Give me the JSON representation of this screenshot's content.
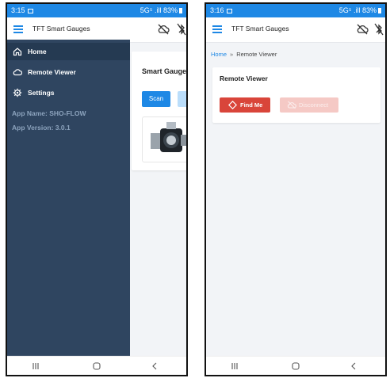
{
  "left_screen": {
    "status": {
      "time": "3:15",
      "right": "5G⁵ .ill 83%"
    },
    "appbar": {
      "title": "TFT Smart Gauges"
    },
    "drawer": {
      "items": [
        {
          "label": "Home",
          "icon": "home-icon",
          "active": true
        },
        {
          "label": "Remote Viewer",
          "icon": "cloud-icon",
          "active": false
        },
        {
          "label": "Settings",
          "icon": "gear-icon",
          "active": false
        }
      ],
      "app_name": "App Name: SHO-FLOW",
      "app_version": "App Version: 3.0.1"
    },
    "card": {
      "title": "Smart Gauges",
      "scan_label": "Scan"
    }
  },
  "right_screen": {
    "status": {
      "time": "3:16",
      "right": "5G⁵ .ill 83%"
    },
    "appbar": {
      "title": "TFT Smart Gauges"
    },
    "breadcrumb": {
      "home": "Home",
      "separator": "»",
      "current": "Remote Viewer"
    },
    "card": {
      "title": "Remote Viewer",
      "find_label": "Find Me",
      "disconnect_label": "Disconnect"
    }
  },
  "colors": {
    "primary": "#1e88e5",
    "drawer_bg": "#2f4560",
    "danger": "#d9453a",
    "danger_disabled": "#f5c9c5"
  }
}
